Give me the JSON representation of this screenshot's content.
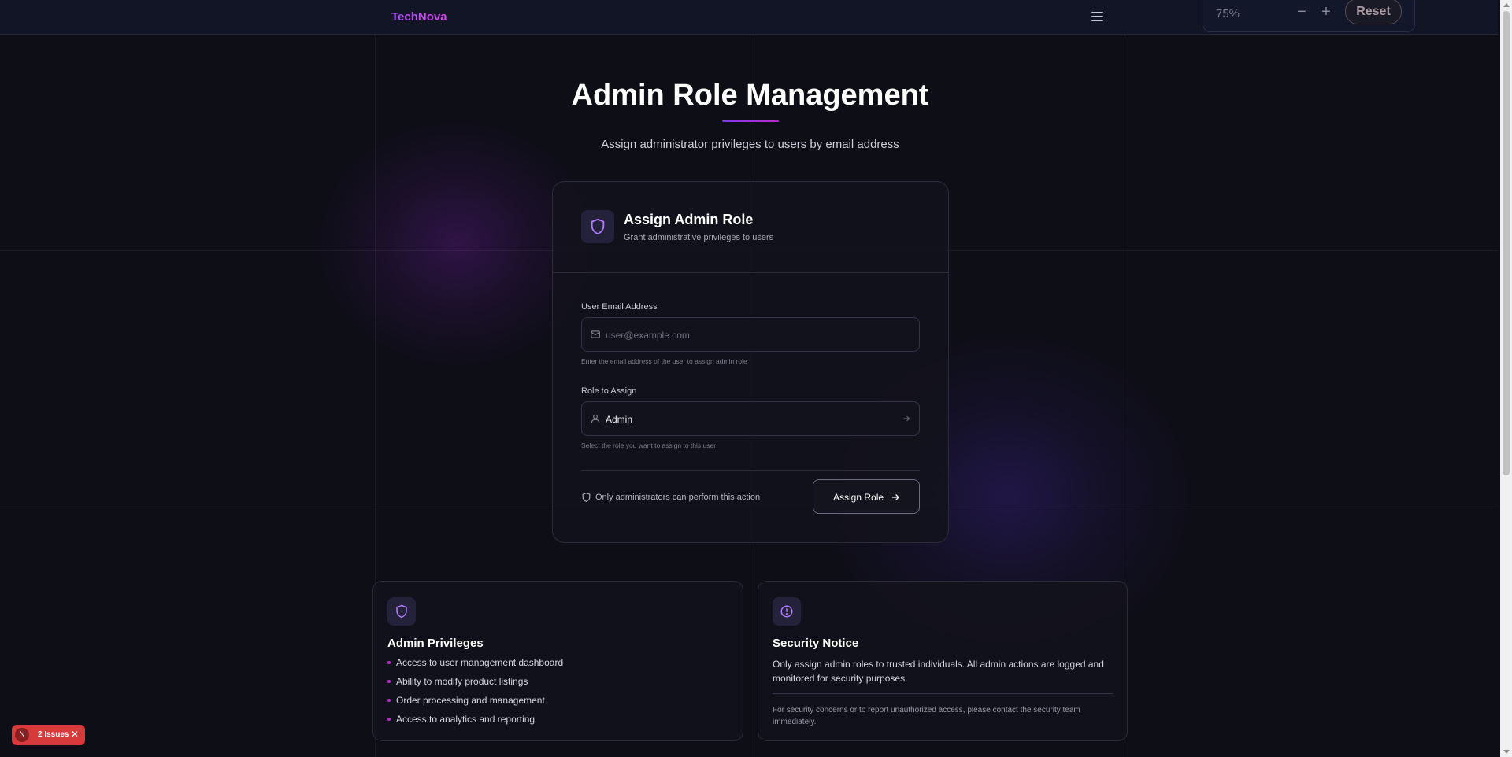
{
  "header": {
    "brand": "TechNova",
    "zoom": {
      "level": "75%",
      "minus": "−",
      "plus": "+",
      "reset": "Reset"
    }
  },
  "page": {
    "title": "Admin Role Management",
    "subtitle": "Assign administrator privileges to users by email address"
  },
  "card": {
    "title": "Assign Admin Role",
    "subtitle": "Grant administrative privileges to users",
    "email": {
      "label": "User Email Address",
      "placeholder": "user@example.com",
      "help": "Enter the email address of the user to assign admin role"
    },
    "role": {
      "label": "Role to Assign",
      "value": "Admin",
      "help": "Select the role you want to assign to this user"
    },
    "notice": "Only administrators can perform this action",
    "submit_label": "Assign Role"
  },
  "privileges": {
    "title": "Admin Privileges",
    "items": [
      "Access to user management dashboard",
      "Ability to modify product listings",
      "Order processing and management",
      "Access to analytics and reporting"
    ]
  },
  "security": {
    "title": "Security Notice",
    "text": "Only assign admin roles to trusted individuals. All admin actions are logged and monitored for security purposes.",
    "small": "For security concerns or to report unauthorized access, please contact the security team immediately."
  },
  "issues_badge": {
    "icon_letter": "N",
    "label": "2 Issues",
    "close": "✕"
  },
  "colors": {
    "accent": "#a855f7",
    "accent2": "#d946ef",
    "background": "#0e0e17",
    "error": "#d63a3a"
  }
}
